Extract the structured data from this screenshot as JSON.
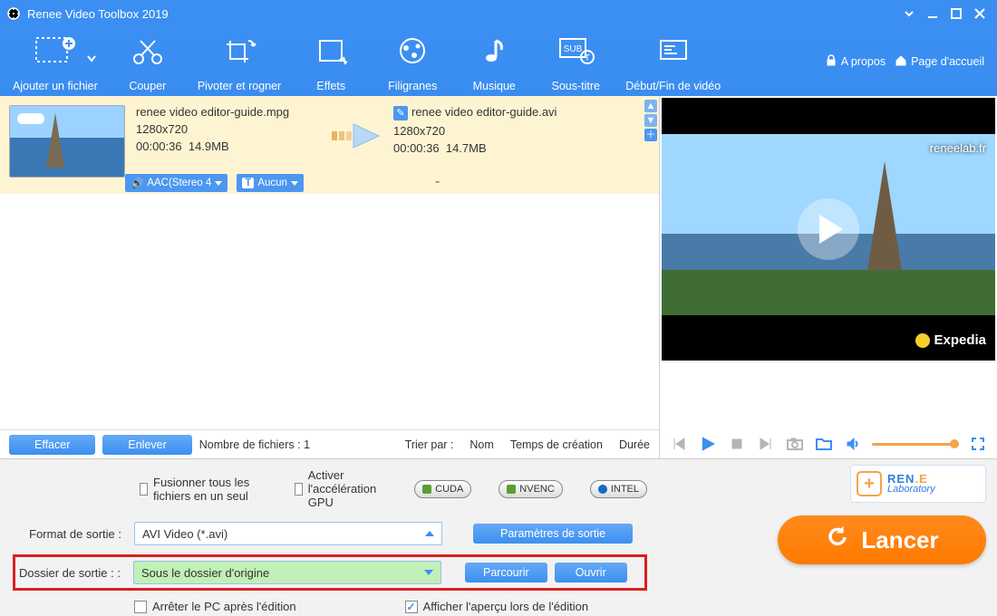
{
  "app": {
    "title": "Renee Video Toolbox 2019"
  },
  "toolbar": {
    "add": {
      "label": "Ajouter un fichier"
    },
    "cut": {
      "label": "Couper"
    },
    "rotate": {
      "label": "Pivoter et rogner"
    },
    "effects": {
      "label": "Effets"
    },
    "watermark": {
      "label": "Filigranes"
    },
    "music": {
      "label": "Musique"
    },
    "subtitle": {
      "label": "Sous-titre"
    },
    "startend": {
      "label": "Début/Fin de vidéo"
    }
  },
  "rightlinks": {
    "about": "A propos",
    "home": "Page d'accueil"
  },
  "item": {
    "source": {
      "name": "renee video editor-guide.mpg",
      "resolution": "1280x720",
      "duration": "00:00:36",
      "size": "14.9MB",
      "audio_tag": "AAC(Stereo 4",
      "subtitle_tag": "Aucun",
      "sub_prefix": "T"
    },
    "target": {
      "name": "renee video editor-guide.avi",
      "resolution": "1280x720",
      "duration": "00:00:36",
      "size": "14.7MB",
      "row_value": "-"
    }
  },
  "queue_footer": {
    "clear": "Effacer",
    "remove": "Enlever",
    "count": "Nombre de fichiers : 1",
    "sortby": "Trier par :",
    "name": "Nom",
    "created": "Temps de création",
    "duration": "Durée"
  },
  "preview": {
    "top_watermark": "reneelab.fr",
    "bottom_watermark": "Expedia"
  },
  "options": {
    "merge": "Fusionner tous les fichiers en un seul",
    "gpu": "Activer l'accélération GPU",
    "enc1": "CUDA",
    "enc2": "NVENC",
    "enc3": "INTEL",
    "format_label": "Format de sortie :",
    "format_value": "AVI Video (*.avi)",
    "settings_btn": "Paramètres de sortie",
    "folder_label": "Dossier de sortie :  :",
    "folder_value": "Sous le dossier d'origine",
    "browse": "Parcourir",
    "open": "Ouvrir",
    "shutdown": "Arrêter le PC après l'édition",
    "preview_after": "Afficher l'aperçu lors de l'édition"
  },
  "brand": {
    "line1a": "REN",
    "line1b": ".E",
    "line2": "Laboratory",
    "plus": "+"
  },
  "launch": {
    "label": "Lancer"
  }
}
